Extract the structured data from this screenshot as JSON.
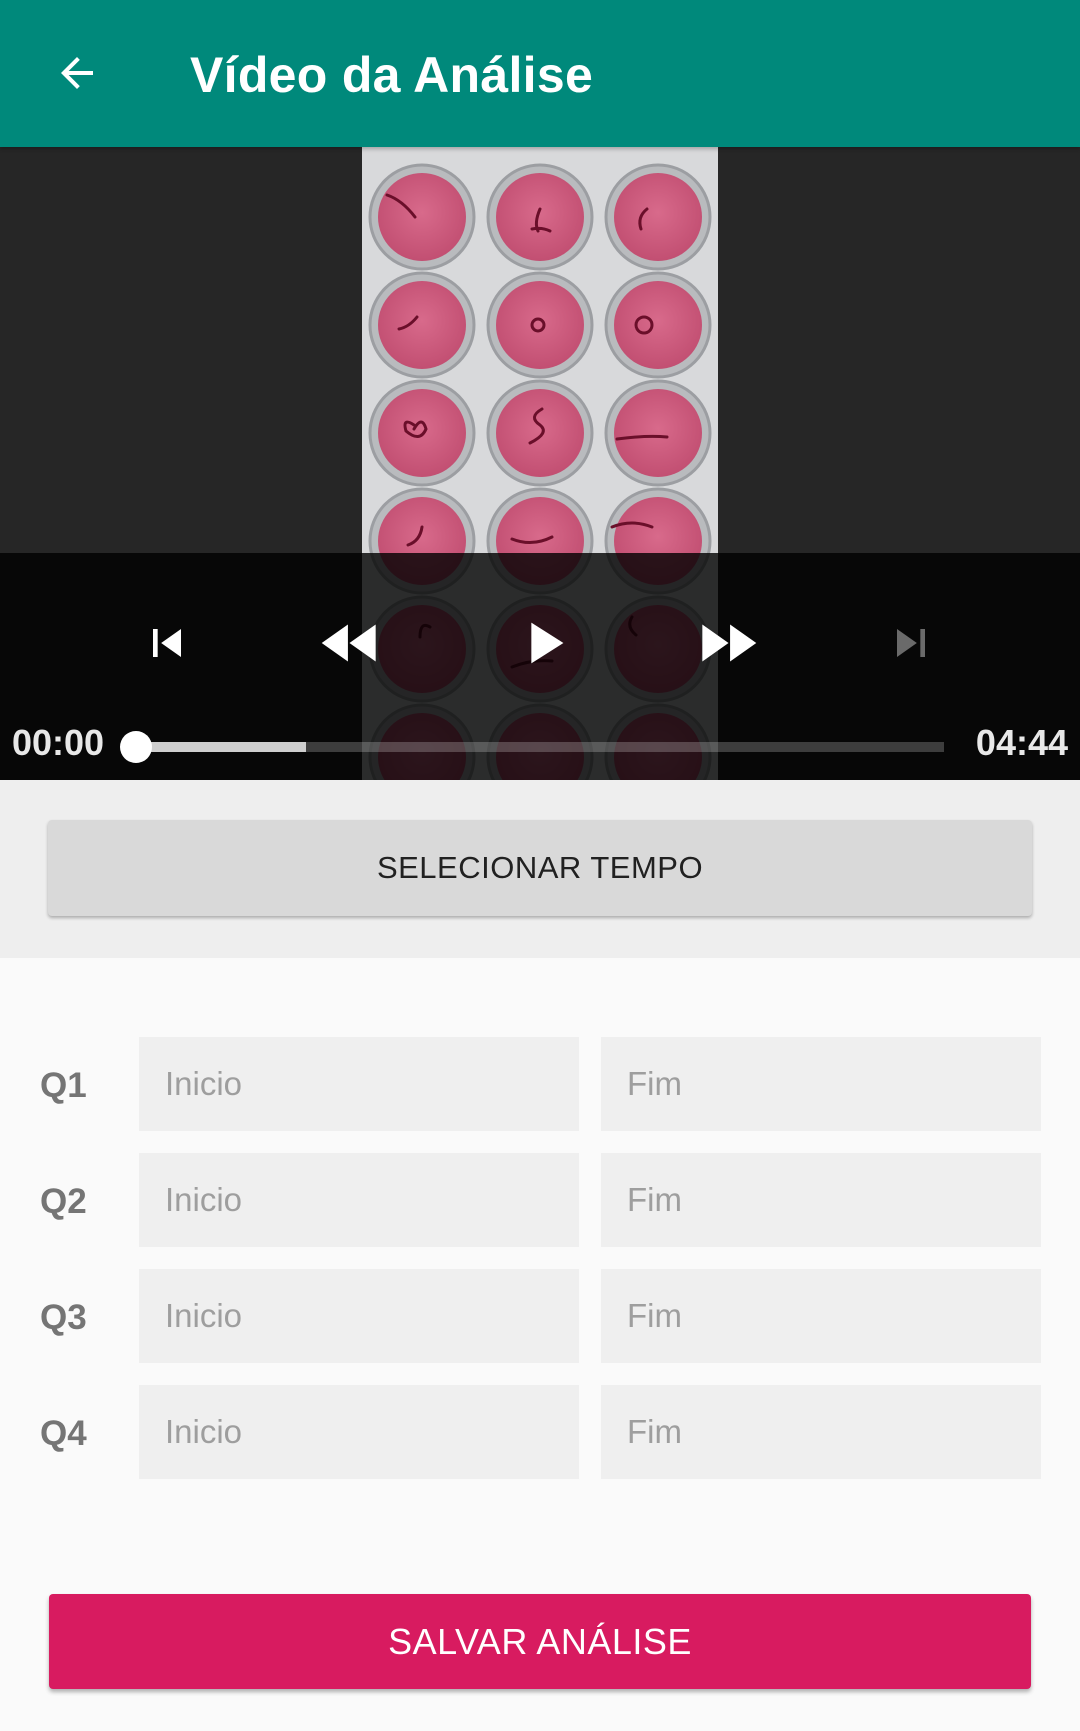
{
  "app_bar": {
    "title": "Vídeo da Análise",
    "back_icon": "arrow-left-icon",
    "background": "#00897b"
  },
  "player": {
    "current_time": "00:00",
    "duration": "04:44",
    "position_fraction": 0.0,
    "buffered_fraction": 0.21,
    "controls": [
      "skip-previous-icon",
      "rewind-icon",
      "play-icon",
      "fast-forward-icon",
      "skip-next-icon"
    ]
  },
  "actions": {
    "select_time_label": "SELECIONAR TEMPO",
    "save_label": "SALVAR ANÁLISE",
    "save_color": "#d81b60"
  },
  "quadrants": [
    {
      "label": "Q1",
      "start_placeholder": "Inicio",
      "end_placeholder": "Fim"
    },
    {
      "label": "Q2",
      "start_placeholder": "Inicio",
      "end_placeholder": "Fim"
    },
    {
      "label": "Q3",
      "start_placeholder": "Inicio",
      "end_placeholder": "Fim"
    },
    {
      "label": "Q4",
      "start_placeholder": "Inicio",
      "end_placeholder": "Fim"
    }
  ]
}
